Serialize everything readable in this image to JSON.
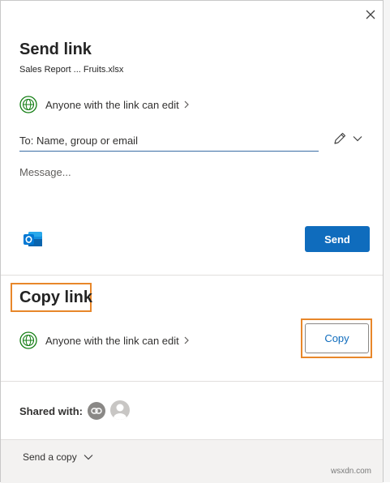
{
  "dialog": {
    "title": "Send link",
    "filename": "Sales Report ... Fruits.xlsx"
  },
  "send_section": {
    "permission": "Anyone with the link can edit",
    "to_placeholder": "To: Name, group or email",
    "message_placeholder": "Message...",
    "send_label": "Send"
  },
  "copy_section": {
    "title": "Copy link",
    "permission": "Anyone with the link can edit",
    "copy_label": "Copy"
  },
  "shared": {
    "label": "Shared with:"
  },
  "footer": {
    "send_copy_label": "Send a copy"
  },
  "watermark": "wsxdn.com",
  "icons": {
    "close": "close-icon",
    "globe": "globe-icon",
    "chevron": "chevron-right-icon",
    "pencil": "pencil-icon",
    "dropdown": "chevron-down-icon",
    "outlook": "outlook-icon",
    "link": "link-icon",
    "person": "person-icon"
  },
  "colors": {
    "accent": "#0f6cbd",
    "highlight": "#e8872a",
    "globe_green": "#107c10"
  }
}
